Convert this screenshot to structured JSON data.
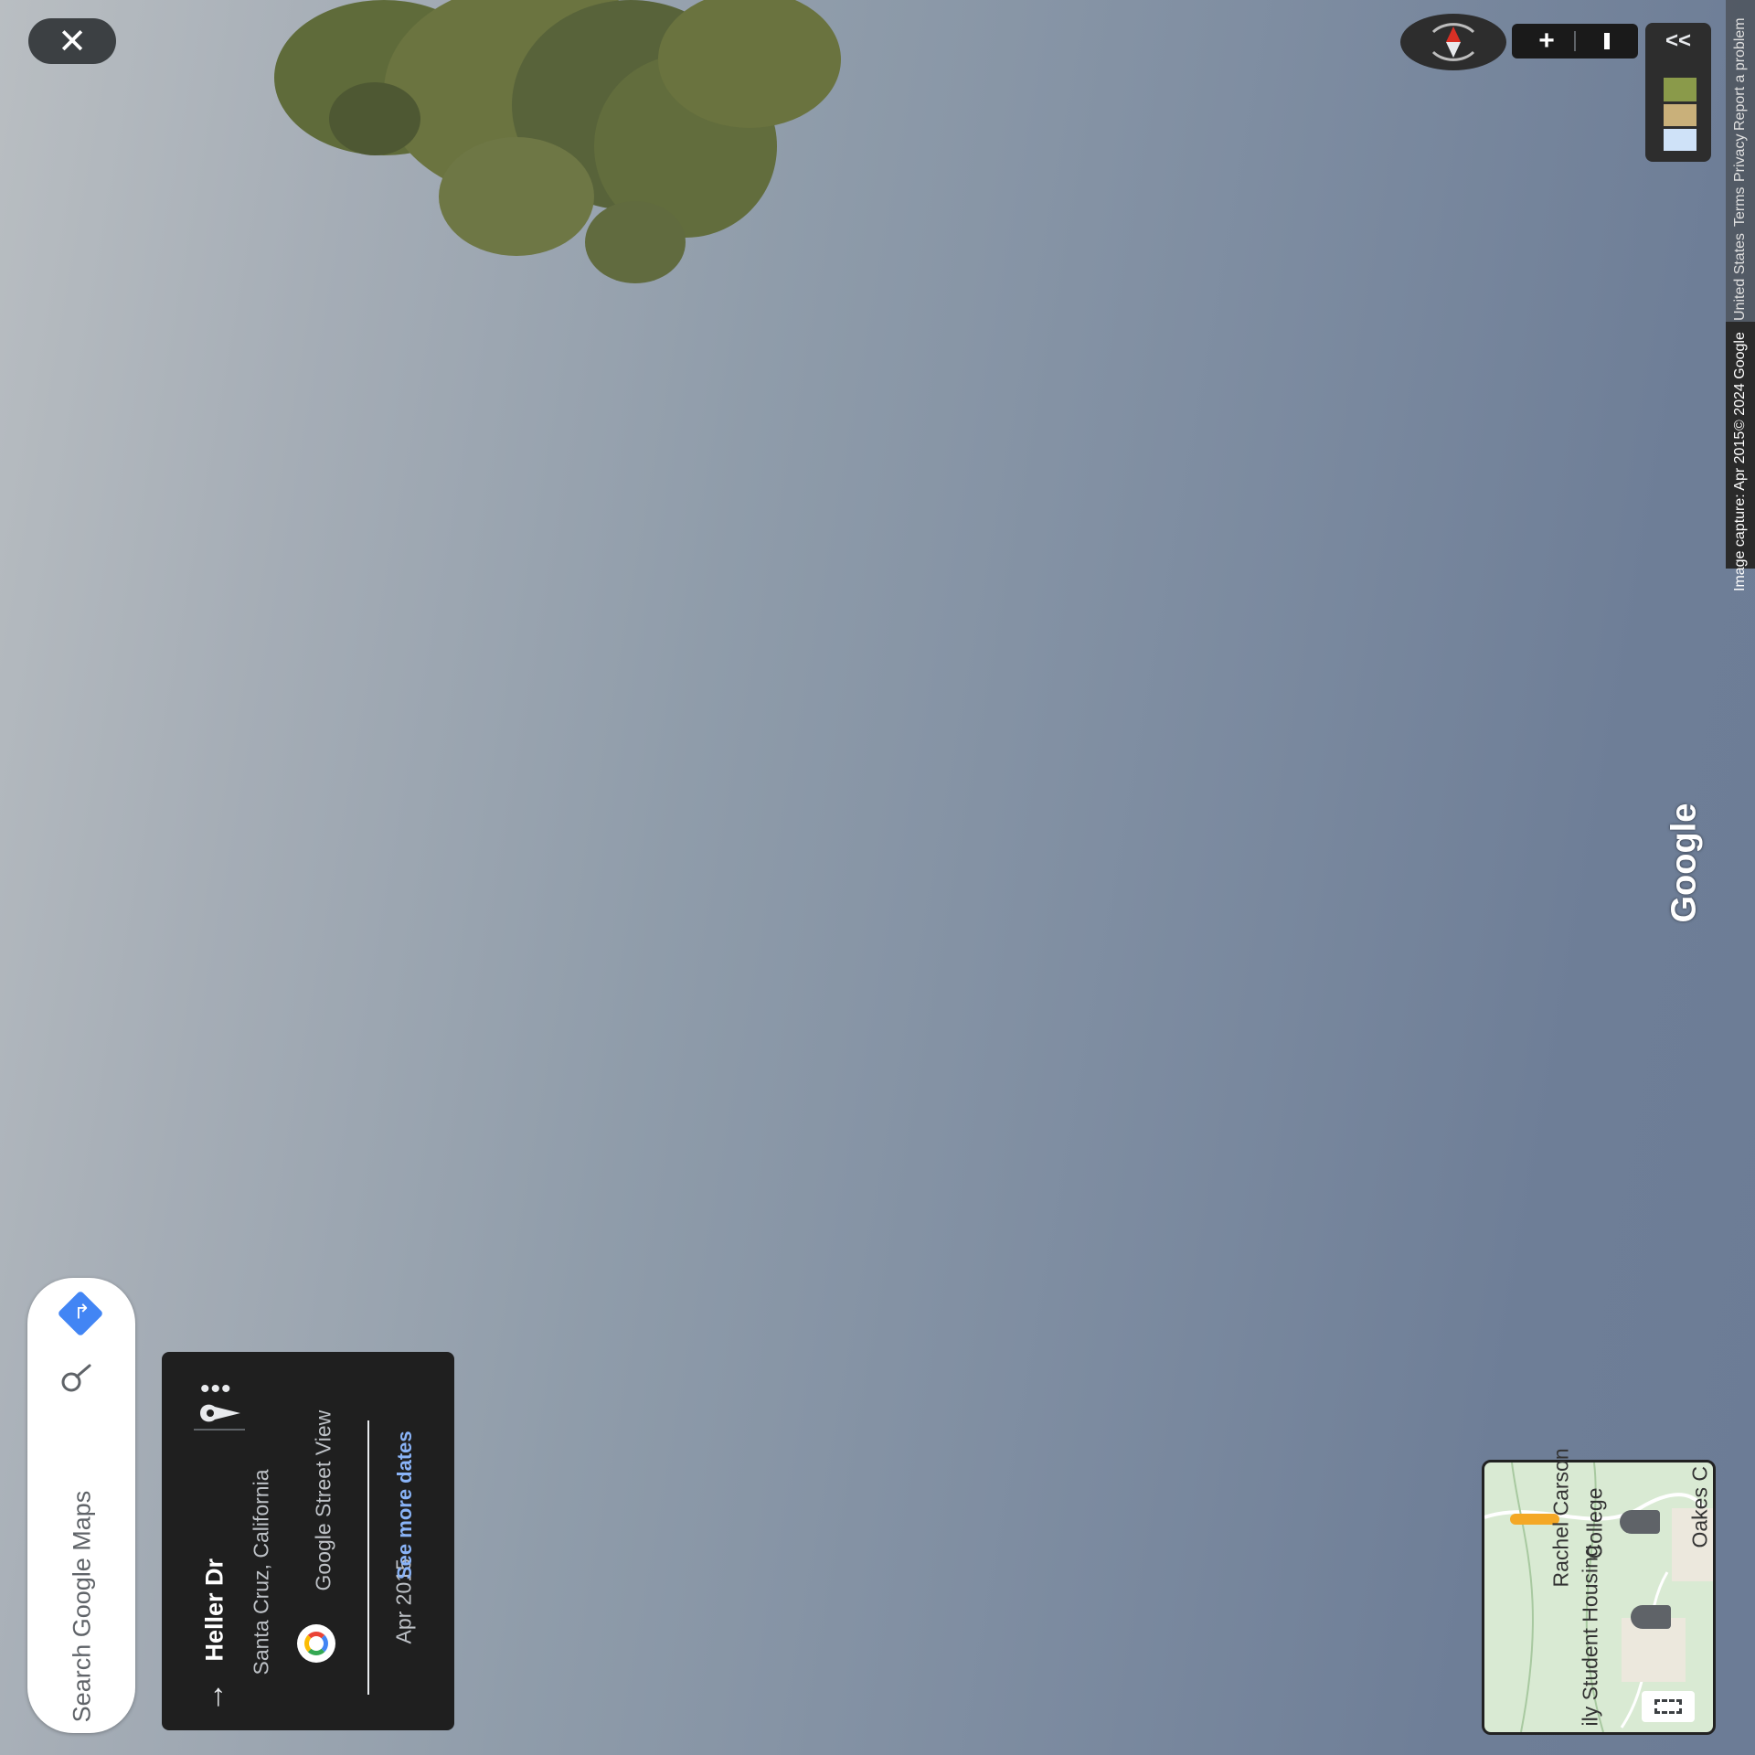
{
  "header": {
    "close_icon": "close-icon"
  },
  "search": {
    "placeholder": "Search Google Maps",
    "search_icon": "search-icon",
    "directions_icon": "directions-icon"
  },
  "info_card": {
    "street": "Heller Dr",
    "city": "Santa Cruz, California",
    "source": "Google Street View",
    "date": "Apr 2015",
    "more_dates": "See more dates",
    "back_icon": "back-arrow-icon",
    "pin_icon": "location-pin-icon",
    "more_icon": "more-options-icon"
  },
  "controls": {
    "zoom_in": "+",
    "zoom_out": "−",
    "collapse": "<<",
    "compass_icon": "compass-icon"
  },
  "attribution": {
    "report": "Report a problem",
    "privacy": "Privacy",
    "terms": "Terms",
    "region": "United States",
    "copyright": "© 2024 Google",
    "capture": "Image capture: Apr 2015"
  },
  "watermark": "Google",
  "minimap": {
    "label_college": "College",
    "label_rachel": "Rachel Carson",
    "label_housing": "ily Student Housing",
    "label_oakes": "Oakes C",
    "expand_icon": "fullscreen-icon"
  },
  "colors": {
    "card_bg": "#1f1f1f",
    "link": "#8ab4f8",
    "pegman": "#f4a826",
    "compass_red": "#d93025"
  }
}
